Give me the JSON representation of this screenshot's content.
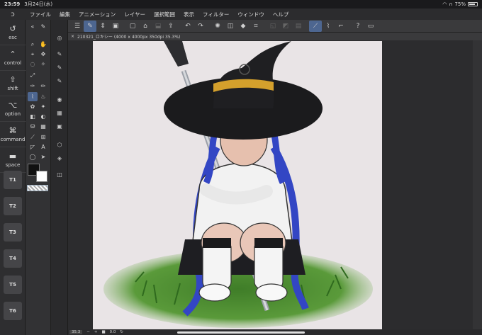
{
  "status": {
    "time": "23:59",
    "date": "3月24日(水)",
    "battery": "75%",
    "battery_level": 0.75
  },
  "menu": [
    "ファイル",
    "編集",
    "アニメーション",
    "レイヤー",
    "選択範囲",
    "表示",
    "フィルター",
    "ウィンドウ",
    "ヘルプ"
  ],
  "document": {
    "tab_title": "210321_ロキシー (4000 x 4000px 350dpi 35.3%)"
  },
  "keys": {
    "esc": "esc",
    "control": "control",
    "shift": "shift",
    "option": "option",
    "command": "command",
    "space": "space",
    "t1": "T1",
    "t2": "T2",
    "t3": "T3",
    "t4": "T4",
    "t5": "T5",
    "t6": "T6"
  },
  "bottom": {
    "zoom": "35.3",
    "angle": "0.0"
  },
  "colors": {
    "accent": "#4d6690",
    "canvas_bg": "#e9e4e6",
    "hair": "#3b48c4",
    "hat": "#1b1b1d",
    "hat_band": "#d4a02c",
    "grass": "#4a8a2e"
  },
  "icons": {
    "menu": "hamburger-icon",
    "pen": "pen-icon",
    "undo": "undo-icon",
    "redo": "redo-icon",
    "hand": "hand-icon",
    "zoom": "magnifier-icon",
    "move": "move-icon",
    "brush": "brush-icon"
  }
}
